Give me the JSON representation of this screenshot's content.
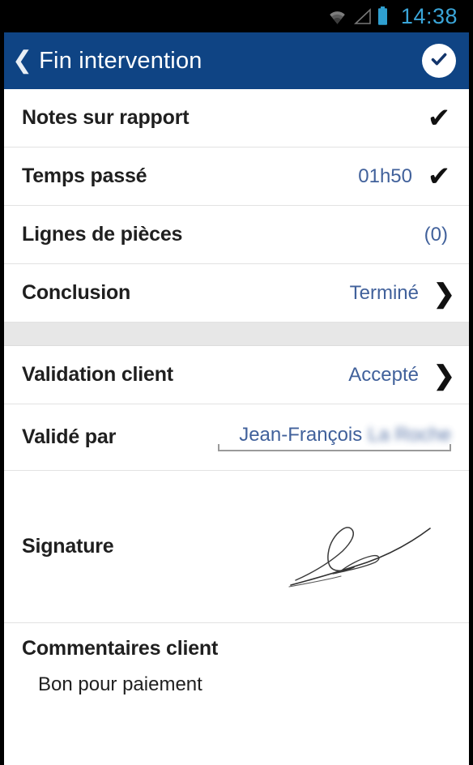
{
  "status_bar": {
    "time": "14:38",
    "icons": [
      "wifi-icon",
      "cell-signal-icon",
      "battery-icon"
    ],
    "clock_color": "#3aa5d8",
    "battery_color": "#2f9fd0",
    "background": "#000000"
  },
  "app_bar": {
    "back_label": "❮",
    "title": "Fin intervention",
    "validate_icon": "check-circle-icon",
    "background": "#0f4484",
    "title_color": "#ffffff"
  },
  "colors": {
    "accent_blue": "#41619b",
    "header_blue": "#0f4484",
    "divider": "#e2e2e2",
    "spacer_gray": "#e7e7e7",
    "label_black": "#1f1f1f"
  },
  "rows": [
    {
      "label": "Notes sur rapport",
      "value": "",
      "accessory": "check",
      "interactable": true
    },
    {
      "label": "Temps passé",
      "value": "01h50",
      "accessory": "check",
      "interactable": true
    },
    {
      "label": "Lignes de pièces",
      "value": "(0)",
      "accessory": "none",
      "interactable": true
    },
    {
      "label": "Conclusion",
      "value": "Terminé",
      "accessory": "chevron",
      "interactable": true
    }
  ],
  "rows_group_two": [
    {
      "label": "Validation client",
      "value": "Accepté",
      "accessory": "chevron",
      "interactable": true
    }
  ],
  "validated_by": {
    "label": "Validé par",
    "value": "Jean-François",
    "redacted_value": "La Roche",
    "placeholder": "Validé par"
  },
  "signature": {
    "label": "Signature",
    "has_signature": true,
    "stroke_color": "#2b2b2b"
  },
  "comments": {
    "header": "Commentaires client",
    "text": "Bon pour paiement"
  }
}
